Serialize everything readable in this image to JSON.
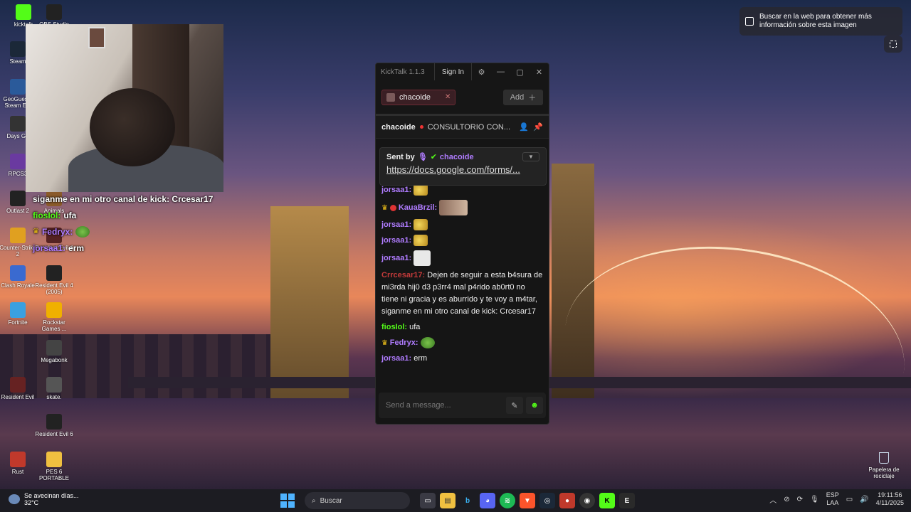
{
  "desktop_icons": [
    {
      "label": "kicktalk",
      "icon": "kicktalk-icon",
      "color": "#53fc18"
    },
    {
      "label": "OBS Studio",
      "icon": "obs-icon",
      "color": "#222222"
    },
    {
      "label": "Steam",
      "icon": "steam-icon",
      "color": "#1b2838"
    },
    {
      "label": "GeoGuessr Steam E...",
      "icon": "geoguessr-icon",
      "color": "#2a5a9a"
    },
    {
      "label": "Days Go",
      "icon": "days-gone-icon",
      "color": "#333333"
    },
    {
      "label": "RPCS3",
      "icon": "rpcs3-icon",
      "color": "#6a3aa0"
    },
    {
      "label": "Outlast 2",
      "icon": "outlast-icon",
      "color": "#222222"
    },
    {
      "label": "Animals",
      "icon": "animals-icon",
      "color": "#8a5a2a"
    },
    {
      "label": "Counter-Strike 2",
      "icon": "cs2-icon",
      "color": "#e0a020"
    },
    {
      "label": "Resident Evil 4",
      "icon": "re4-icon",
      "color": "#552222"
    },
    {
      "label": "Clash Royale",
      "icon": "clash-icon",
      "color": "#3a6ad0"
    },
    {
      "label": "Resident Evil 4 (2005)",
      "icon": "re4-2005-icon",
      "color": "#222222"
    },
    {
      "label": "Fortnite",
      "icon": "fortnite-icon",
      "color": "#3aa0e0"
    },
    {
      "label": "Rockstar Games ...",
      "icon": "rockstar-icon",
      "color": "#f0b000"
    },
    {
      "label": "Megabonk",
      "icon": "megabonk-icon",
      "color": "#444444"
    },
    {
      "label": "Resident Evil",
      "icon": "re-icon",
      "color": "#662222"
    },
    {
      "label": "skate.",
      "icon": "skate-icon",
      "color": "#555555"
    },
    {
      "label": "Resident Evil 6",
      "icon": "re6-icon",
      "color": "#222222"
    },
    {
      "label": "Rust",
      "icon": "rust-icon",
      "color": "#c0392b"
    },
    {
      "label": "PES 6 PORTABLE",
      "icon": "folder-icon",
      "color": "#f0c040"
    }
  ],
  "lens": {
    "text": "Buscar en la web para obtener más información sobre esta imagen"
  },
  "recycle": {
    "label": "Papelera de reciclaje"
  },
  "overlay_chat": {
    "line1": "siganme en mi otro canal de kick: Crcesar17",
    "line2_user": "fiosIol:",
    "line2_text": "ufa",
    "line3_user": "Fedryx:",
    "line4_user": "jorsaa1:",
    "line4_text": "erm"
  },
  "kicktalk": {
    "version": "KickTalk 1.1.3",
    "sign_in": "Sign In",
    "tab_name": "chacoide",
    "add_label": "Add",
    "channel_name": "chacoide",
    "stream_title": "CONSULTORIO CON...",
    "pinned": {
      "sent_by": "Sent by",
      "user": "chacoide",
      "link": "https://docs.google.com/forms/..."
    },
    "messages": [
      {
        "user": "jorsaa1:",
        "text": "",
        "emote": "banana"
      },
      {
        "user": "KauaBrzil:",
        "text": "",
        "emote": "photo"
      },
      {
        "user": "jorsaa1:",
        "text": "",
        "emote": "banana"
      },
      {
        "user": "jorsaa1:",
        "text": "",
        "emote": "banana"
      },
      {
        "user": "jorsaa1:",
        "text": "",
        "emote": "meme"
      },
      {
        "user": "Crrcesar17:",
        "text": "Dejen de seguir a esta b4sura de mi3rda hij0 d3 p3rr4 mal p4rido ab0rt0 no tiene ni gracia y es aburrido y te voy a m4tar, siganme en mi otro canal de kick: Crcesar17"
      },
      {
        "user": "fiosIol:",
        "text": "ufa"
      },
      {
        "user": "Fedryx:",
        "text": "",
        "emote": "frog"
      },
      {
        "user": "jorsaa1:",
        "text": "erm"
      }
    ],
    "input_placeholder": "Send a message..."
  },
  "taskbar": {
    "weather_text": "Se avecinan días...",
    "weather_temp": "32°C",
    "search_label": "Buscar",
    "lang_top": "ESP",
    "lang_bottom": "LAA",
    "time": "19:11:56",
    "date": "4/11/2025"
  }
}
